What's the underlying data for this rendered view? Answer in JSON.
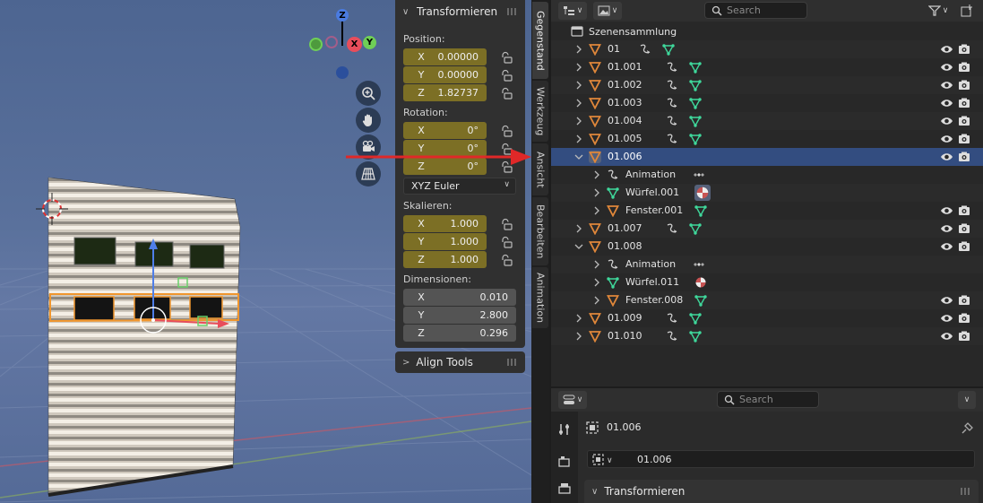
{
  "npanel": {
    "title": "Transformieren",
    "position_label": "Position:",
    "position": [
      {
        "axis": "X",
        "value": "0.00000"
      },
      {
        "axis": "Y",
        "value": "0.00000"
      },
      {
        "axis": "Z",
        "value": "1.82737"
      }
    ],
    "rotation_label": "Rotation:",
    "rotation": [
      {
        "axis": "X",
        "value": "0°"
      },
      {
        "axis": "Y",
        "value": "0°"
      },
      {
        "axis": "Z",
        "value": "0°"
      }
    ],
    "rotation_mode": "XYZ Euler",
    "scale_label": "Skalieren:",
    "scale": [
      {
        "axis": "X",
        "value": "1.000"
      },
      {
        "axis": "Y",
        "value": "1.000"
      },
      {
        "axis": "Z",
        "value": "1.000"
      }
    ],
    "dimensions_label": "Dimensionen:",
    "dimensions": [
      {
        "axis": "X",
        "value": "0.010"
      },
      {
        "axis": "Y",
        "value": "2.800"
      },
      {
        "axis": "Z",
        "value": "0.296"
      }
    ],
    "align_tools": "Align Tools"
  },
  "gizmo": {
    "z": "Z",
    "y": "Y",
    "x": "X"
  },
  "tabs": [
    "Gegenstand",
    "Werkzeug",
    "Ansicht",
    "Bearbeiten",
    "Animation"
  ],
  "outliner": {
    "search_placeholder": "Search",
    "collection": "Szenensammlung",
    "rows": [
      {
        "name": "01",
        "level": 0,
        "kind": "obj",
        "expand": ">",
        "mods": [
          "anim",
          "mesh"
        ],
        "vis": true
      },
      {
        "name": "01.001",
        "level": 0,
        "kind": "obj",
        "expand": ">",
        "mods": [
          "anim",
          "mesh"
        ],
        "vis": true
      },
      {
        "name": "01.002",
        "level": 0,
        "kind": "obj",
        "expand": ">",
        "mods": [
          "anim",
          "mesh"
        ],
        "vis": true
      },
      {
        "name": "01.003",
        "level": 0,
        "kind": "obj",
        "expand": ">",
        "mods": [
          "anim",
          "mesh"
        ],
        "vis": true
      },
      {
        "name": "01.004",
        "level": 0,
        "kind": "obj",
        "expand": ">",
        "mods": [
          "anim",
          "mesh"
        ],
        "vis": true
      },
      {
        "name": "01.005",
        "level": 0,
        "kind": "obj",
        "expand": ">",
        "mods": [
          "anim",
          "mesh"
        ],
        "vis": true
      },
      {
        "name": "01.006",
        "level": 0,
        "kind": "obj",
        "expand": "v",
        "mods": [],
        "vis": true,
        "selected": true
      },
      {
        "name": "Animation",
        "level": 1,
        "kind": "anim",
        "expand": ">",
        "mods": [
          "action"
        ],
        "vis": false
      },
      {
        "name": "Würfel.001",
        "level": 1,
        "kind": "mesh",
        "expand": ">",
        "mods": [
          "material-box"
        ],
        "vis": false
      },
      {
        "name": "Fenster.001",
        "level": 1,
        "kind": "obj",
        "expand": ">",
        "mods": [
          "mesh"
        ],
        "vis": true
      },
      {
        "name": "01.007",
        "level": 0,
        "kind": "obj",
        "expand": ">",
        "mods": [
          "anim",
          "mesh"
        ],
        "vis": true
      },
      {
        "name": "01.008",
        "level": 0,
        "kind": "obj",
        "expand": "v",
        "mods": [],
        "vis": true
      },
      {
        "name": "Animation",
        "level": 1,
        "kind": "anim",
        "expand": ">",
        "mods": [
          "action"
        ],
        "vis": false
      },
      {
        "name": "Würfel.011",
        "level": 1,
        "kind": "mesh",
        "expand": ">",
        "mods": [
          "material"
        ],
        "vis": false
      },
      {
        "name": "Fenster.008",
        "level": 1,
        "kind": "obj",
        "expand": ">",
        "mods": [
          "mesh"
        ],
        "vis": true
      },
      {
        "name": "01.009",
        "level": 0,
        "kind": "obj",
        "expand": ">",
        "mods": [
          "anim",
          "mesh"
        ],
        "vis": true
      },
      {
        "name": "01.010",
        "level": 0,
        "kind": "obj",
        "expand": ">",
        "mods": [
          "anim",
          "mesh"
        ],
        "vis": true
      }
    ]
  },
  "properties": {
    "search_placeholder": "Search",
    "object_name": "01.006",
    "name_field": "01.006",
    "panel": "Transformieren"
  },
  "colors": {
    "accent_selection": "#334d80",
    "field_animated": "#7c6f25",
    "object_orange": "#e0873a",
    "mesh_green": "#3fd99c",
    "arrow_red": "#e02828"
  }
}
